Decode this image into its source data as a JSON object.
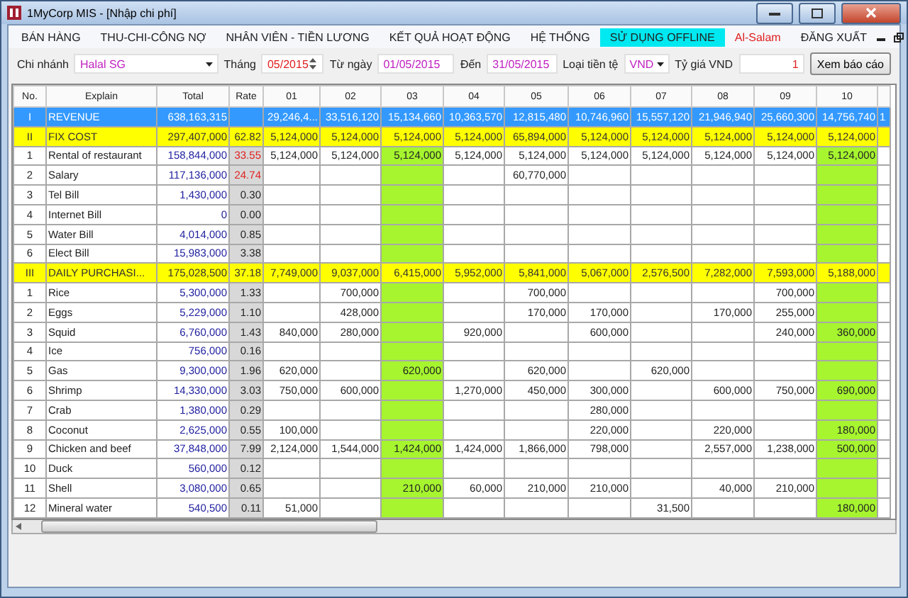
{
  "window": {
    "title": "1MyCorp MIS  - [Nhập chi phí]"
  },
  "menu": [
    {
      "label": "BÁN HÀNG",
      "kind": "normal",
      "selected": false
    },
    {
      "label": "THU-CHI-CÔNG NỢ",
      "kind": "normal",
      "selected": false
    },
    {
      "label": "NHÂN VIÊN - TIỀN LƯƠNG",
      "kind": "normal",
      "selected": false
    },
    {
      "label": "KẾT QUẢ HOẠT ĐỘNG",
      "kind": "normal",
      "selected": false
    },
    {
      "label": "HỆ THỐNG",
      "kind": "normal",
      "selected": false
    },
    {
      "label": "SỬ DỤNG OFFLINE",
      "kind": "normal",
      "selected": true
    },
    {
      "label": "Al-Salam",
      "kind": "brand",
      "selected": false
    },
    {
      "label": "ĐĂNG XUẤT",
      "kind": "normal",
      "selected": false
    }
  ],
  "filters": {
    "branch_label": "Chi nhánh",
    "branch": "Halal SG",
    "month_label": "Tháng",
    "month": "05/2015",
    "from_label": "Từ ngày",
    "from": "01/05/2015",
    "to_label": "Đến",
    "to": "31/05/2015",
    "currency_label": "Loại tiền tệ",
    "currency": "VND",
    "rate_label": "Tỷ giá VND",
    "rate": "1",
    "report_button": "Xem báo cáo"
  },
  "table": {
    "fixed_columns": [
      "No.",
      "Explain",
      "Total",
      "Rate"
    ],
    "columns": [
      {
        "label": "01",
        "highlight": false
      },
      {
        "label": "02",
        "highlight": false
      },
      {
        "label": "03",
        "highlight": true
      },
      {
        "label": "04",
        "highlight": false
      },
      {
        "label": "05",
        "highlight": false
      },
      {
        "label": "06",
        "highlight": false
      },
      {
        "label": "07",
        "highlight": false
      },
      {
        "label": "08",
        "highlight": false
      },
      {
        "label": "09",
        "highlight": false
      },
      {
        "label": "10",
        "highlight": true
      },
      {
        "highlight": false
      }
    ],
    "rows": [
      {
        "kind": "revenue",
        "no": "I",
        "explain": "REVENUE",
        "total": "638,163,315",
        "cells": [
          {
            "text": "29,246,4..."
          },
          {
            "text": "33,516,120"
          },
          {
            "text": "15,134,660"
          },
          {
            "text": "10,363,570"
          },
          {
            "text": "12,815,480"
          },
          {
            "text": "10,746,960"
          },
          {
            "text": "15,557,120"
          },
          {
            "text": "21,946,940"
          },
          {
            "text": "25,660,300"
          },
          {
            "text": "14,756,740"
          },
          {
            "text": "1"
          }
        ]
      },
      {
        "kind": "group",
        "no": "II",
        "explain": "FIX COST",
        "total": "297,407,000",
        "rate": "62.82",
        "rate_alert": false,
        "cells": [
          {
            "text": "5,124,000"
          },
          {
            "text": "5,124,000"
          },
          {
            "text": "5,124,000"
          },
          {
            "text": "5,124,000"
          },
          {
            "text": "65,894,000"
          },
          {
            "text": "5,124,000"
          },
          {
            "text": "5,124,000"
          },
          {
            "text": "5,124,000"
          },
          {
            "text": "5,124,000"
          },
          {
            "text": "5,124,000"
          }
        ]
      },
      {
        "kind": "item",
        "no": "1",
        "explain": "Rental of restaurant",
        "total": "158,844,000",
        "rate": "33.55",
        "rate_alert": true,
        "cells": [
          {
            "text": "5,124,000"
          },
          {
            "text": "5,124,000"
          },
          {
            "text": "5,124,000"
          },
          {
            "text": "5,124,000"
          },
          {
            "text": "5,124,000"
          },
          {
            "text": "5,124,000"
          },
          {
            "text": "5,124,000"
          },
          {
            "text": "5,124,000"
          },
          {
            "text": "5,124,000"
          },
          {
            "text": "5,124,000"
          }
        ]
      },
      {
        "kind": "item",
        "no": "2",
        "explain": "Salary",
        "total": "117,136,000",
        "rate": "24.74",
        "rate_alert": true,
        "cells": [
          {},
          {},
          {},
          {},
          {
            "text": "60,770,000"
          }
        ]
      },
      {
        "kind": "item",
        "no": "3",
        "explain": "Tel Bill",
        "total": "1,430,000",
        "rate": "0.30",
        "rate_alert": false
      },
      {
        "kind": "item",
        "no": "4",
        "explain": "Internet Bill",
        "total": "0",
        "rate": "0.00",
        "rate_alert": false
      },
      {
        "kind": "item",
        "no": "5",
        "explain": "Water Bill",
        "total": "4,014,000",
        "rate": "0.85",
        "rate_alert": false
      },
      {
        "kind": "item",
        "no": "6",
        "explain": "Elect Bill",
        "total": "15,983,000",
        "rate": "3.38",
        "rate_alert": false
      },
      {
        "kind": "group",
        "no": "III",
        "explain": "DAILY PURCHASI...",
        "total": "175,028,500",
        "rate": "37.18",
        "rate_alert": false,
        "cells": [
          {
            "text": "7,749,000"
          },
          {
            "text": "9,037,000"
          },
          {
            "text": "6,415,000"
          },
          {
            "text": "5,952,000"
          },
          {
            "text": "5,841,000"
          },
          {
            "text": "5,067,000"
          },
          {
            "text": "2,576,500"
          },
          {
            "text": "7,282,000"
          },
          {
            "text": "7,593,000"
          },
          {
            "text": "5,188,000"
          }
        ]
      },
      {
        "kind": "item",
        "no": "1",
        "explain": "Rice",
        "total": "5,300,000",
        "rate": "1.33",
        "rate_alert": false,
        "cells": [
          {},
          {
            "text": "700,000"
          },
          {},
          {},
          {
            "text": "700,000"
          },
          {},
          {},
          {},
          {
            "text": "700,000"
          }
        ]
      },
      {
        "kind": "item",
        "no": "2",
        "explain": "Eggs",
        "total": "5,229,000",
        "rate": "1.10",
        "rate_alert": false,
        "cells": [
          {},
          {
            "text": "428,000"
          },
          {},
          {},
          {
            "text": "170,000"
          },
          {
            "text": "170,000"
          },
          {},
          {
            "text": "170,000"
          },
          {
            "text": "255,000"
          }
        ]
      },
      {
        "kind": "item",
        "no": "3",
        "explain": "Squid",
        "total": "6,760,000",
        "rate": "1.43",
        "rate_alert": false,
        "cells": [
          {
            "text": "840,000"
          },
          {
            "text": "280,000"
          },
          {},
          {
            "text": "920,000"
          },
          {},
          {
            "text": "600,000"
          },
          {},
          {},
          {
            "text": "240,000"
          },
          {
            "text": "360,000"
          }
        ]
      },
      {
        "kind": "item",
        "no": "4",
        "explain": "Ice",
        "total": "756,000",
        "rate": "0.16",
        "rate_alert": false
      },
      {
        "kind": "item",
        "no": "5",
        "explain": "Gas",
        "total": "9,300,000",
        "rate": "1.96",
        "rate_alert": false,
        "cells": [
          {
            "text": "620,000"
          },
          {},
          {
            "text": "620,000"
          },
          {},
          {
            "text": "620,000"
          },
          {},
          {
            "text": "620,000"
          }
        ]
      },
      {
        "kind": "item",
        "no": "6",
        "explain": "Shrimp",
        "total": "14,330,000",
        "rate": "3.03",
        "rate_alert": false,
        "cells": [
          {
            "text": "750,000"
          },
          {
            "text": "600,000"
          },
          {},
          {
            "text": "1,270,000"
          },
          {
            "text": "450,000"
          },
          {
            "text": "300,000"
          },
          {},
          {
            "text": "600,000"
          },
          {
            "text": "750,000"
          },
          {
            "text": "690,000"
          }
        ]
      },
      {
        "kind": "item",
        "no": "7",
        "explain": "Crab",
        "total": "1,380,000",
        "rate": "0.29",
        "rate_alert": false,
        "cells": [
          {},
          {},
          {},
          {},
          {},
          {
            "text": "280,000"
          }
        ]
      },
      {
        "kind": "item",
        "no": "8",
        "explain": "Coconut",
        "total": "2,625,000",
        "rate": "0.55",
        "rate_alert": false,
        "cells": [
          {
            "text": "100,000"
          },
          {},
          {},
          {},
          {},
          {
            "text": "220,000"
          },
          {},
          {
            "text": "220,000"
          },
          {},
          {
            "text": "180,000"
          }
        ]
      },
      {
        "kind": "item",
        "no": "9",
        "explain": "Chicken and beef",
        "total": "37,848,000",
        "rate": "7.99",
        "rate_alert": false,
        "cells": [
          {
            "text": "2,124,000"
          },
          {
            "text": "1,544,000"
          },
          {
            "text": "1,424,000"
          },
          {
            "text": "1,424,000"
          },
          {
            "text": "1,866,000"
          },
          {
            "text": "798,000"
          },
          {},
          {
            "text": "2,557,000"
          },
          {
            "text": "1,238,000"
          },
          {
            "text": "500,000"
          }
        ]
      },
      {
        "kind": "item",
        "no": "10",
        "explain": "Duck",
        "total": "560,000",
        "rate": "0.12",
        "rate_alert": false
      },
      {
        "kind": "item",
        "no": "11",
        "explain": "Shell",
        "total": "3,080,000",
        "rate": "0.65",
        "rate_alert": false,
        "cells": [
          {},
          {},
          {
            "text": "210,000"
          },
          {
            "text": "60,000"
          },
          {
            "text": "210,000"
          },
          {
            "text": "210,000"
          },
          {},
          {
            "text": "40,000"
          },
          {
            "text": "210,000"
          }
        ]
      },
      {
        "kind": "item",
        "no": "12",
        "explain": "Mineral water",
        "total": "540,500",
        "rate": "0.11",
        "rate_alert": false,
        "cells": [
          {
            "text": "51,000"
          },
          {},
          {},
          {},
          {},
          {},
          {
            "text": "31,500"
          },
          {},
          {},
          {
            "text": "180,000"
          }
        ]
      }
    ]
  }
}
